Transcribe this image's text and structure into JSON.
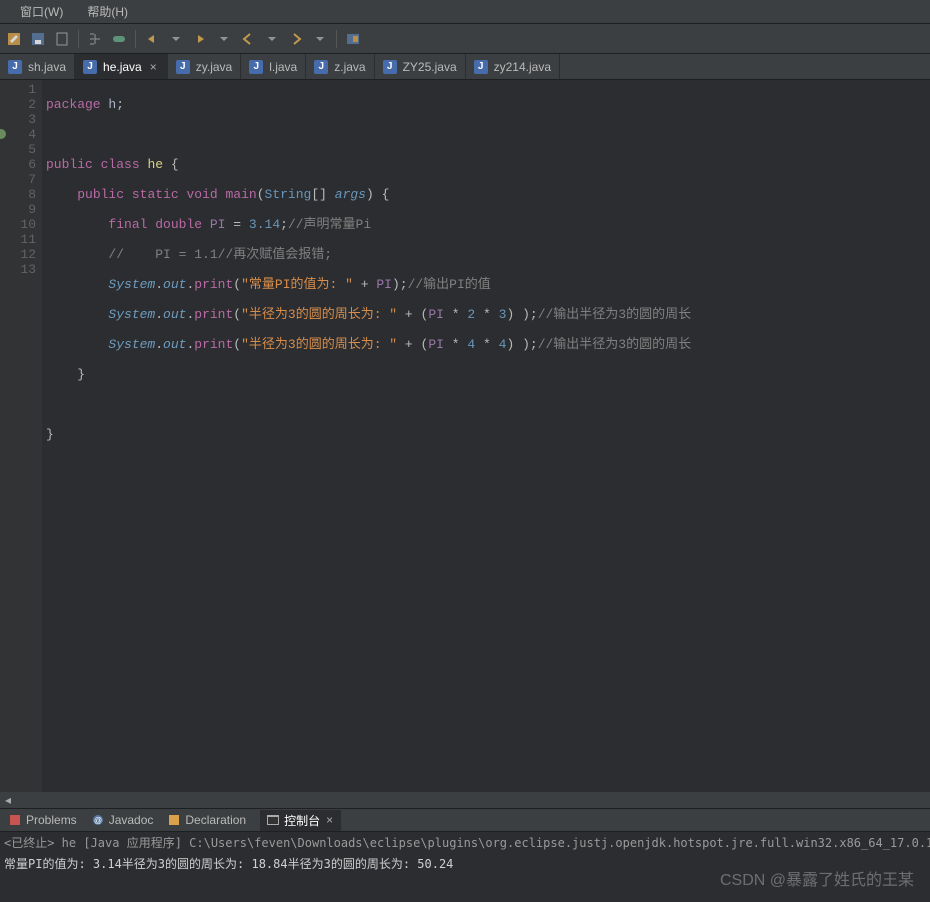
{
  "menu": {
    "window": "窗口(W)",
    "help": "帮助(H)"
  },
  "tabs": [
    {
      "label": "sh.java"
    },
    {
      "label": "he.java",
      "active": true
    },
    {
      "label": "zy.java"
    },
    {
      "label": "l.java"
    },
    {
      "label": "z.java"
    },
    {
      "label": "ZY25.java"
    },
    {
      "label": "zy214.java"
    }
  ],
  "gutter_lines": [
    "1",
    "2",
    "3",
    "4",
    "5",
    "6",
    "7",
    "8",
    "9",
    "10",
    "11",
    "12",
    "13"
  ],
  "breakpoint_line": 4,
  "code": {
    "l1": {
      "kw1": "package",
      "pkg": "h",
      "sc": ";"
    },
    "l3": {
      "kw1": "public",
      "kw2": "class",
      "name": "he",
      "br": "{"
    },
    "l4": {
      "kw1": "public",
      "kw2": "static",
      "kw3": "void",
      "m": "main",
      "lp": "(",
      "t": "String",
      "arr": "[]",
      "a": "args",
      "rp": ")",
      "br": "{"
    },
    "l5": {
      "kw1": "final",
      "kw2": "double",
      "c": "PI",
      "eq": "=",
      "n": "3.14",
      "sc": ";",
      "cm": "//声明常量Pi"
    },
    "l6": {
      "cm": "//    PI = 1.1//再次赋值会报错;"
    },
    "l7": {
      "cls": "System",
      "d1": ".",
      "f": "out",
      "d2": ".",
      "m": "print",
      "lp": "(",
      "s": "\"常量PI的值为: \"",
      "plus": "+",
      "c": "PI",
      "rp": ");",
      "cm": "//输出PI的值"
    },
    "l8": {
      "cls": "System",
      "d1": ".",
      "f": "out",
      "d2": ".",
      "m": "print",
      "lp": "(",
      "s": "\"半径为3的圆的周长为: \"",
      "plus": "+",
      "lp2": "(",
      "c": "PI",
      "op1": "*",
      "n1": "2",
      "op2": "*",
      "n2": "3",
      "rp2": ") );",
      "cm": "//输出半径为3的圆的周长"
    },
    "l9": {
      "cls": "System",
      "d1": ".",
      "f": "out",
      "d2": ".",
      "m": "print",
      "lp": "(",
      "s": "\"半径为3的圆的周长为: \"",
      "plus": "+",
      "lp2": "(",
      "c": "PI",
      "op1": "*",
      "n1": "4",
      "op2": "*",
      "n2": "4",
      "rp2": ") );",
      "cm": "//输出半径为3的圆的周长"
    },
    "l10": {
      "br": "}"
    },
    "l12": {
      "br": "}"
    }
  },
  "bottom_tabs": {
    "problems": "Problems",
    "javadoc": "Javadoc",
    "declaration": "Declaration",
    "console": "控制台"
  },
  "console": {
    "header": "<已终止> he [Java 应用程序] C:\\Users\\feven\\Downloads\\eclipse\\plugins\\org.eclipse.justj.openjdk.hotspot.jre.full.win32.x86_64_17.0.1.v20211116-1657\\jre\\bin\\ja",
    "output": "常量PI的值为: 3.14半径为3的圆的周长为: 18.84半径为3的圆的周长为: 50.24"
  },
  "watermark": "CSDN @暴露了姓氏的王某"
}
